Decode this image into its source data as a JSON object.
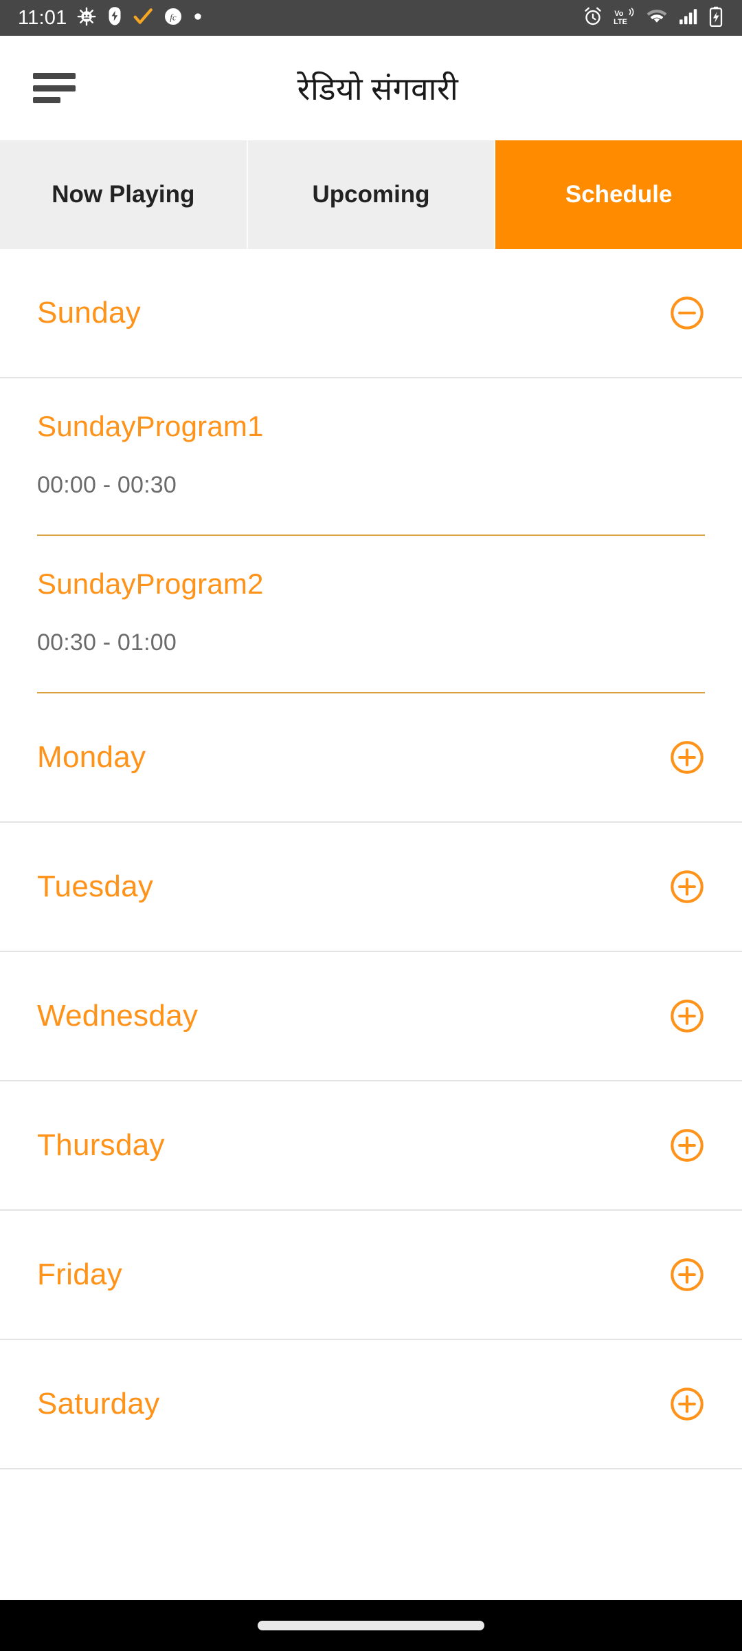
{
  "statusbar": {
    "time": "11:01",
    "left_icons": [
      "android-debug-icon",
      "usb-icon",
      "orange-check-icon",
      "fc-app-icon",
      "dot-icon"
    ],
    "right_icons": [
      "alarm-icon",
      "volte-icon",
      "wifi-icon",
      "signal-icon",
      "battery-charging-icon"
    ],
    "background": "#474747"
  },
  "appbar": {
    "menu_icon": "hamburger-menu-icon",
    "title": "रेडियो संगवारी"
  },
  "tabs": [
    {
      "label": "Now Playing",
      "active": false
    },
    {
      "label": "Upcoming",
      "active": false
    },
    {
      "label": "Schedule",
      "active": true
    }
  ],
  "theme": {
    "accent": "#FF8C00",
    "accent_text": "#FF9218",
    "tab_inactive_bg": "#eeeeee",
    "divider": "#e3e3e3",
    "program_divider": "#d9a23f",
    "time_text": "#6b6b6b"
  },
  "schedule": {
    "days": [
      {
        "name": "Sunday",
        "expanded": true,
        "toggle_icon": "minus-circle-icon",
        "programs": [
          {
            "title": "SundayProgram1",
            "time": "00:00 - 00:30"
          },
          {
            "title": "SundayProgram2",
            "time": "00:30 - 01:00"
          }
        ]
      },
      {
        "name": "Monday",
        "expanded": false,
        "toggle_icon": "plus-circle-icon",
        "programs": []
      },
      {
        "name": "Tuesday",
        "expanded": false,
        "toggle_icon": "plus-circle-icon",
        "programs": []
      },
      {
        "name": "Wednesday",
        "expanded": false,
        "toggle_icon": "plus-circle-icon",
        "programs": []
      },
      {
        "name": "Thursday",
        "expanded": false,
        "toggle_icon": "plus-circle-icon",
        "programs": []
      },
      {
        "name": "Friday",
        "expanded": false,
        "toggle_icon": "plus-circle-icon",
        "programs": []
      },
      {
        "name": "Saturday",
        "expanded": false,
        "toggle_icon": "plus-circle-icon",
        "programs": []
      }
    ]
  },
  "navbar": {
    "gesture_pill": "home-gesture-pill"
  }
}
